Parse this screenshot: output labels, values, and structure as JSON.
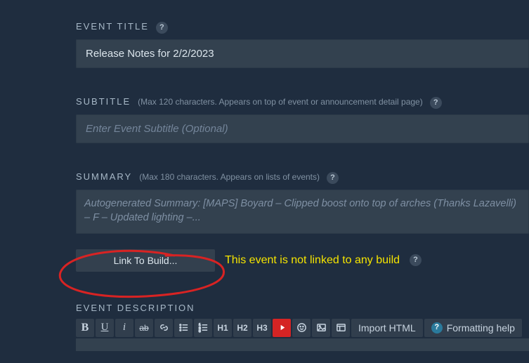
{
  "eventTitle": {
    "label": "EVENT TITLE",
    "value": "Release Notes for 2/2/2023"
  },
  "subtitle": {
    "label": "SUBTITLE",
    "hint": "(Max 120 characters. Appears on top of event or announcement detail page)",
    "placeholder": "Enter Event Subtitle (Optional)",
    "value": ""
  },
  "summary": {
    "label": "SUMMARY",
    "hint": "(Max 180 characters. Appears on lists of events)",
    "text": "Autogenerated Summary: [MAPS] Boyard – Clipped boost onto top of arches (Thanks Lazavelli) – F – Updated lighting –..."
  },
  "linkBuild": {
    "button": "Link To Build...",
    "status": "This event is not linked to any build"
  },
  "description": {
    "label": "EVENT DESCRIPTION"
  },
  "toolbar": {
    "bold": "B",
    "underline": "U",
    "italic": "i",
    "strike": "ab",
    "h1": "H1",
    "h2": "H2",
    "h3": "H3",
    "importHtml": "Import HTML",
    "formattingHelp": "Formatting help"
  },
  "glyphs": {
    "help": "?"
  }
}
